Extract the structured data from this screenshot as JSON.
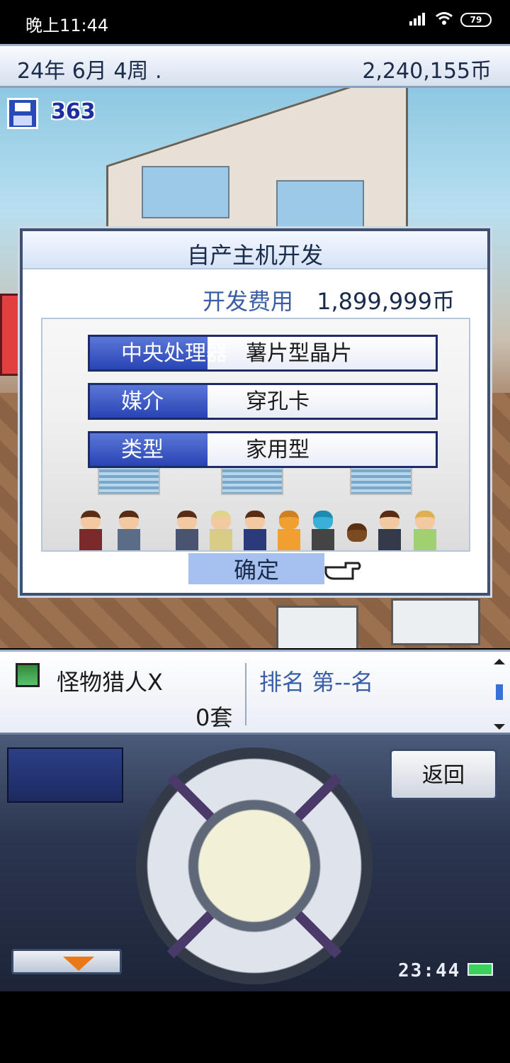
{
  "status_bar": {
    "time": "晚上11:44",
    "battery": "79",
    "icons": [
      "signal-icon",
      "wifi-icon",
      "battery-icon"
    ]
  },
  "top_bar": {
    "date": "24年 6月 4周 .",
    "money": "2,240,155币"
  },
  "save_badge": {
    "count": "363"
  },
  "dialog": {
    "title": "自产主机开发",
    "cost_label": "开发费用",
    "cost_value": "1,899,999币",
    "rows": [
      {
        "label": "中央处理器",
        "value": "薯片型晶片"
      },
      {
        "label": "媒介",
        "value": "穿孔卡"
      },
      {
        "label": "类型",
        "value": "家用型"
      }
    ],
    "confirm_label": "确定"
  },
  "info_panel": {
    "game_name": "怪物猎人X",
    "sales": "0套",
    "rank": "排名 第--名"
  },
  "controller": {
    "back_label": "返回",
    "time": "23:44"
  }
}
